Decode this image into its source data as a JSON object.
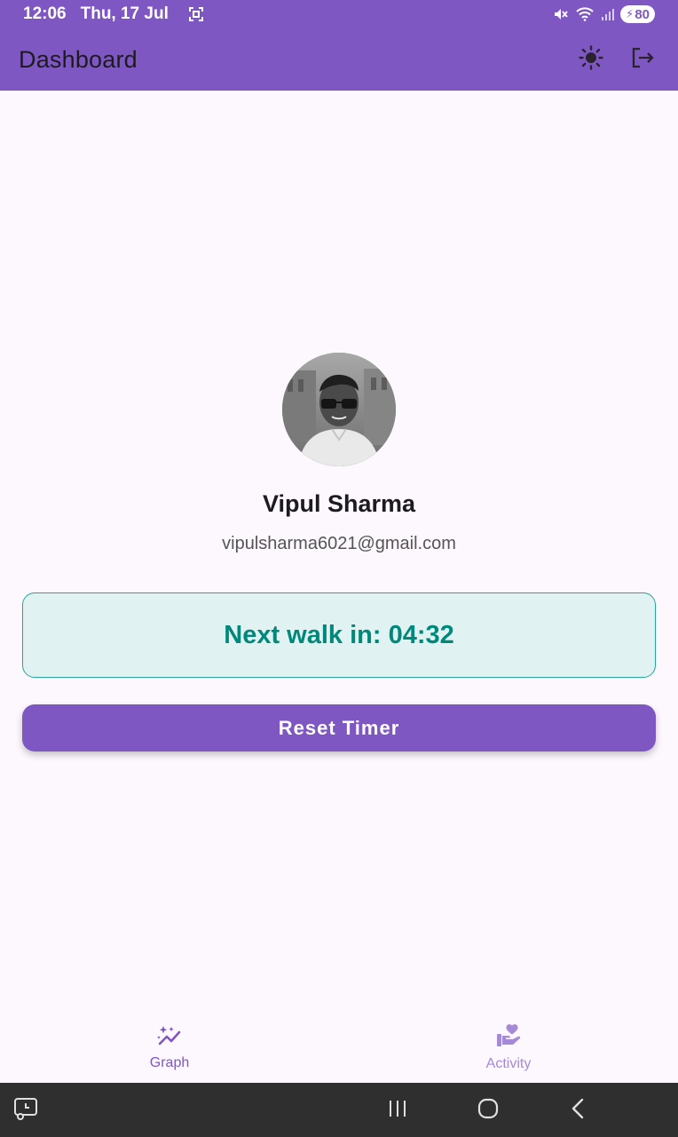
{
  "status_bar": {
    "time": "12:06",
    "date": "Thu, 17 Jul",
    "battery": "80",
    "icons": [
      "screenshot-icon",
      "mute-icon",
      "wifi-icon",
      "signal-icon",
      "battery-icon"
    ]
  },
  "app_bar": {
    "title": "Dashboard",
    "actions": [
      "theme-toggle-icon",
      "logout-icon"
    ]
  },
  "profile": {
    "name": "Vipul Sharma",
    "email": "vipulsharma6021@gmail.com"
  },
  "timer": {
    "text": "Next walk in: 04:32"
  },
  "reset_button": {
    "label": "Reset Timer"
  },
  "bottom_nav": {
    "items": [
      {
        "label": "Graph",
        "icon": "graph-sparkle-icon",
        "active": true
      },
      {
        "label": "Activity",
        "icon": "hand-heart-icon",
        "active": false
      }
    ]
  },
  "system_nav": {
    "buttons": [
      "screen-recorder-icon",
      "recents-icon",
      "home-icon",
      "back-icon"
    ]
  },
  "colors": {
    "primary": "#7e57c2",
    "teal": "#00897b",
    "teal_bg": "#e0f2f1",
    "background": "#fdf7fe"
  }
}
